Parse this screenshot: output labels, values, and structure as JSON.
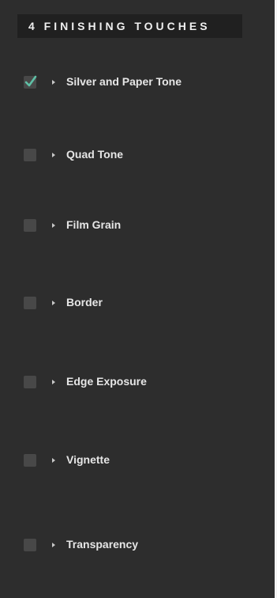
{
  "header": {
    "title": "4 FINISHING TOUCHES"
  },
  "colors": {
    "panel_bg": "#2d2d2d",
    "header_bg": "#202020",
    "checkmark": "#5fc0a6"
  },
  "items": [
    {
      "label": "Silver and Paper Tone",
      "checked": true
    },
    {
      "label": "Quad Tone",
      "checked": false
    },
    {
      "label": "Film Grain",
      "checked": false
    },
    {
      "label": "Border",
      "checked": false
    },
    {
      "label": "Edge Exposure",
      "checked": false
    },
    {
      "label": "Vignette",
      "checked": false
    },
    {
      "label": "Transparency",
      "checked": false
    }
  ]
}
